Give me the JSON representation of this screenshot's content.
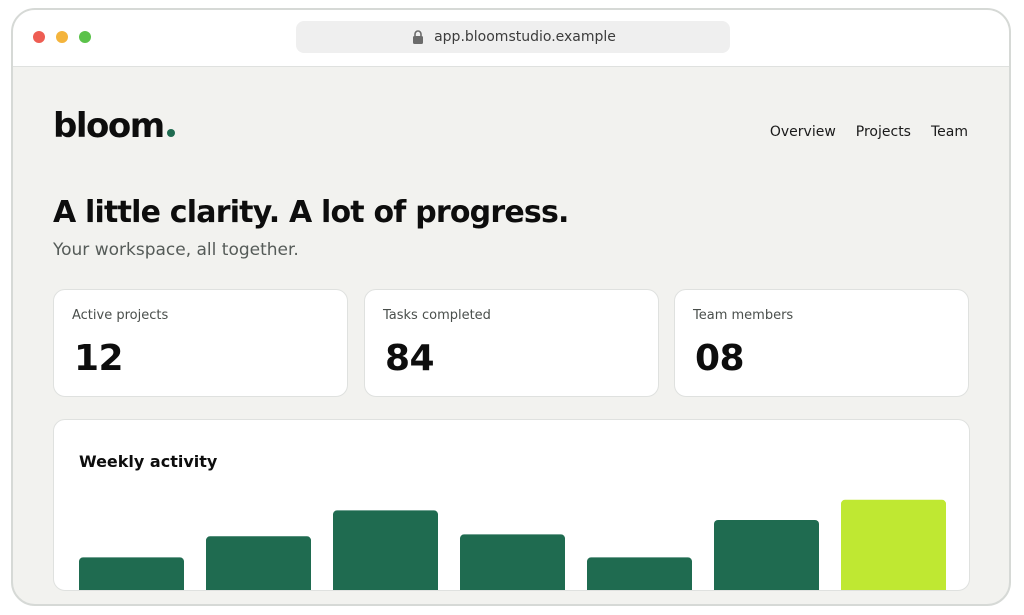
{
  "browser": {
    "url": "app.bloomstudio.example",
    "dot_colors": [
      "#ee5d53",
      "#f4b43c",
      "#5bc24a"
    ]
  },
  "brand": {
    "logo_text": "bloom",
    "accent": "#1f6b50",
    "highlight": "#bfe832"
  },
  "nav": {
    "items": [
      "Overview",
      "Projects",
      "Team"
    ]
  },
  "hero": {
    "headline": "A little clarity. A lot of progress.",
    "subhead": "Your workspace, all together."
  },
  "stats": [
    {
      "label": "Active projects",
      "value": "12"
    },
    {
      "label": "Tasks completed",
      "value": "84"
    },
    {
      "label": "Team members",
      "value": "08"
    }
  ],
  "chart_data": {
    "type": "bar",
    "title": "Weekly activity",
    "categories": [],
    "values": [
      36,
      58,
      85,
      60,
      36,
      75,
      96
    ],
    "ylim": [
      0,
      100
    ],
    "highlight_index": 6,
    "bar_color": "#1f6b50",
    "highlight_color": "#bfe832",
    "grid": false,
    "legend": "none"
  }
}
